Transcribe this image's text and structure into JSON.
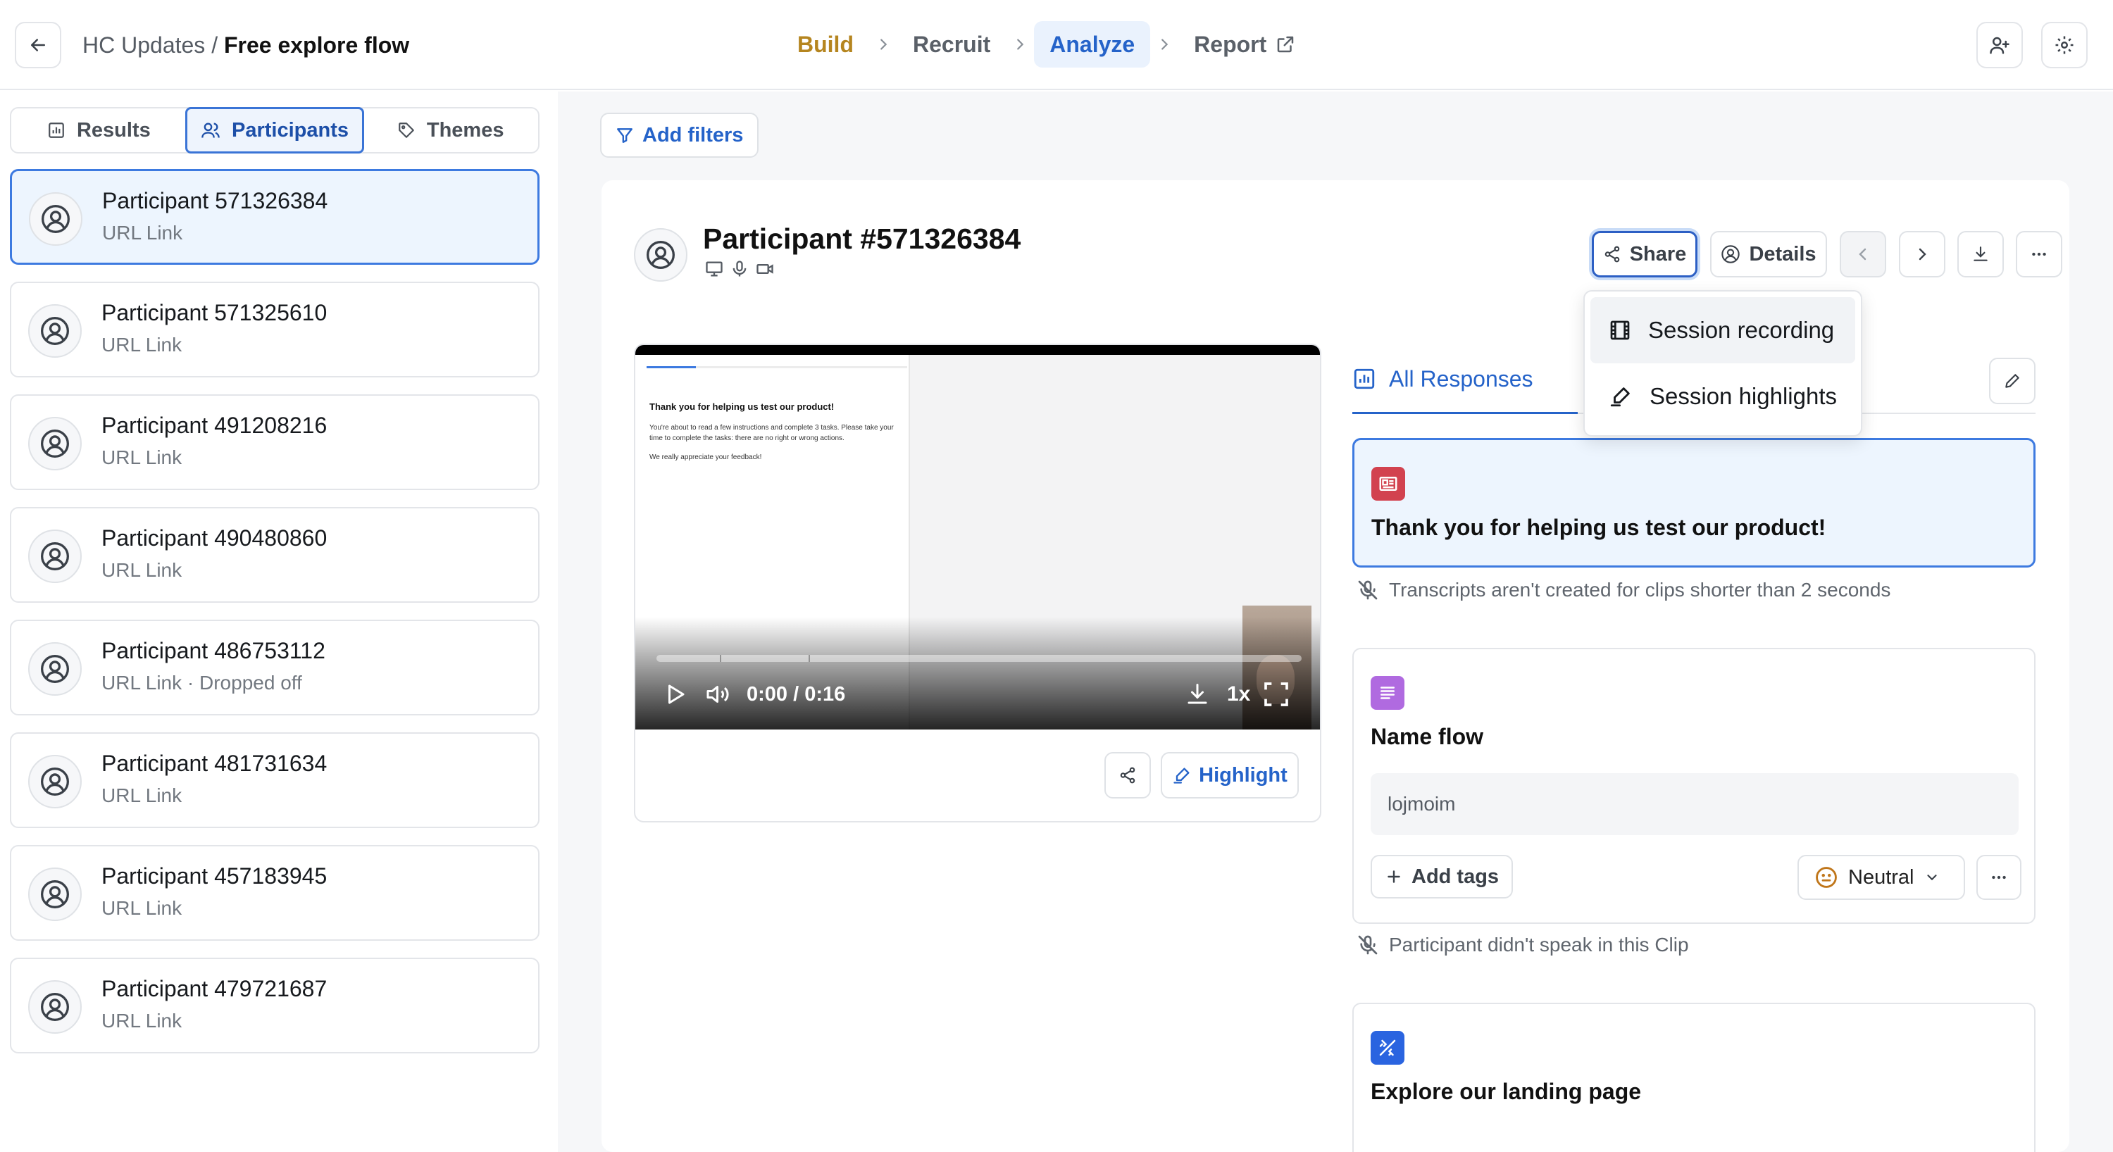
{
  "breadcrumb": {
    "project": "HC Updates",
    "separator": " / ",
    "flow": "Free explore flow"
  },
  "steps": {
    "build": "Build",
    "recruit": "Recruit",
    "analyze": "Analyze",
    "report": "Report"
  },
  "tabs": {
    "results": "Results",
    "participants": "Participants",
    "themes": "Themes"
  },
  "participants": [
    {
      "name": "Participant 571326384",
      "sub": "URL Link"
    },
    {
      "name": "Participant 571325610",
      "sub": "URL Link"
    },
    {
      "name": "Participant 491208216",
      "sub": "URL Link"
    },
    {
      "name": "Participant 490480860",
      "sub": "URL Link"
    },
    {
      "name": "Participant 486753112",
      "sub": "URL Link · Dropped off"
    },
    {
      "name": "Participant 481731634",
      "sub": "URL Link"
    },
    {
      "name": "Participant 457183945",
      "sub": "URL Link"
    },
    {
      "name": "Participant 479721687",
      "sub": "URL Link"
    }
  ],
  "filters": {
    "add_label": "Add filters"
  },
  "detail": {
    "title": "Participant #571326384",
    "share_label": "Share",
    "details_label": "Details"
  },
  "share_menu": {
    "session_recording": "Session recording",
    "session_highlights": "Session highlights"
  },
  "video": {
    "screen_heading": "Thank you for helping us test our product!",
    "screen_body": "You're about to read a few instructions and complete 3 tasks. Please take your time to complete the tasks: there are no right or wrong actions.",
    "screen_footer": "We really appreciate your feedback!",
    "time": "0:00 / 0:16",
    "speed": "1x",
    "highlight_label": "Highlight"
  },
  "responses": {
    "tab_label": "All Responses",
    "card1_title": "Thank you for helping us test our product!",
    "note1": "Transcripts aren't created for clips shorter than 2 seconds",
    "card2_title": "Name flow",
    "card2_answer": "lojmoim",
    "add_tags_label": "Add tags",
    "sentiment": "Neutral",
    "note2": "Participant didn't speak in this Clip",
    "card3_title": "Explore our landing page"
  },
  "colors": {
    "accent": "#2563c9",
    "build": "#b5851f",
    "selected_bg": "#edf5fe"
  }
}
